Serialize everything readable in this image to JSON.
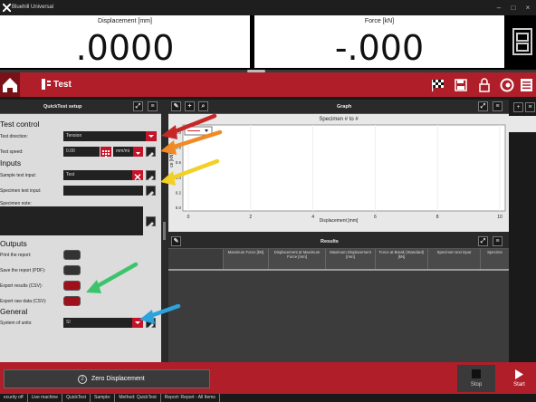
{
  "app": {
    "title": "Bluehill Universal"
  },
  "meters": [
    {
      "label": "Displacement [mm]",
      "value": ".0000"
    },
    {
      "label": "Force [kN]",
      "value": "-.000"
    }
  ],
  "nav": {
    "title": "Test"
  },
  "left_panel": {
    "title": "QuickTest setup",
    "sections": {
      "test_control": "Test control",
      "inputs": "Inputs",
      "outputs": "Outputs",
      "general": "General"
    },
    "test_direction": {
      "label": "Test direction:",
      "value": "Tension"
    },
    "test_speed": {
      "label": "Test speed:",
      "value": "0.00",
      "unit": "mm/mi"
    },
    "sample_text": {
      "label": "Sample text input:",
      "value": "Test"
    },
    "specimen_text": {
      "label": "Specimen text input:",
      "value": ""
    },
    "specimen_note": {
      "label": "Specimen note:"
    },
    "print_report": {
      "label": "Print the report:",
      "on": false
    },
    "save_report": {
      "label": "Save the report (PDF):",
      "on": false
    },
    "export_results": {
      "label": "Export results (CSV):",
      "on": true
    },
    "export_raw": {
      "label": "Export raw data (CSV):",
      "on": true
    },
    "units": {
      "label": "System of units:",
      "value": "SI"
    }
  },
  "graph": {
    "title": "Graph",
    "chart_title": "Specimen # to #",
    "ylabel": "ce [kN]",
    "xlabel": "Displacement [mm]",
    "x_ticks": [
      "0",
      "2",
      "4",
      "6",
      "8",
      "10"
    ],
    "y_ticks": [
      "1.0",
      "0.8",
      "0.6",
      "0.4",
      "0.2",
      "0.0"
    ]
  },
  "results": {
    "title": "Results",
    "columns": [
      "Maximum Force [kN]",
      "Displacement at Maximum Force [mm]",
      "Maximum Displacement [mm]",
      "Force at Break (Standard) [kN]",
      "Specimen text input",
      "Specime"
    ]
  },
  "bottom": {
    "zero_num": "2",
    "zero_label": "Zero Displacement",
    "stop": "Stop",
    "start": "Start"
  },
  "status": [
    "ecurity off",
    "Live machine",
    "QuickTest",
    "Sample:",
    "Method: QuickTest",
    "Report: Report - All Items"
  ],
  "colors": {
    "accent": "#b01e2a",
    "arrow_red": "#c62828",
    "arrow_orange": "#f08a24",
    "arrow_yellow": "#f2d025",
    "arrow_green": "#3cc46c",
    "arrow_blue": "#2ba3dd"
  }
}
